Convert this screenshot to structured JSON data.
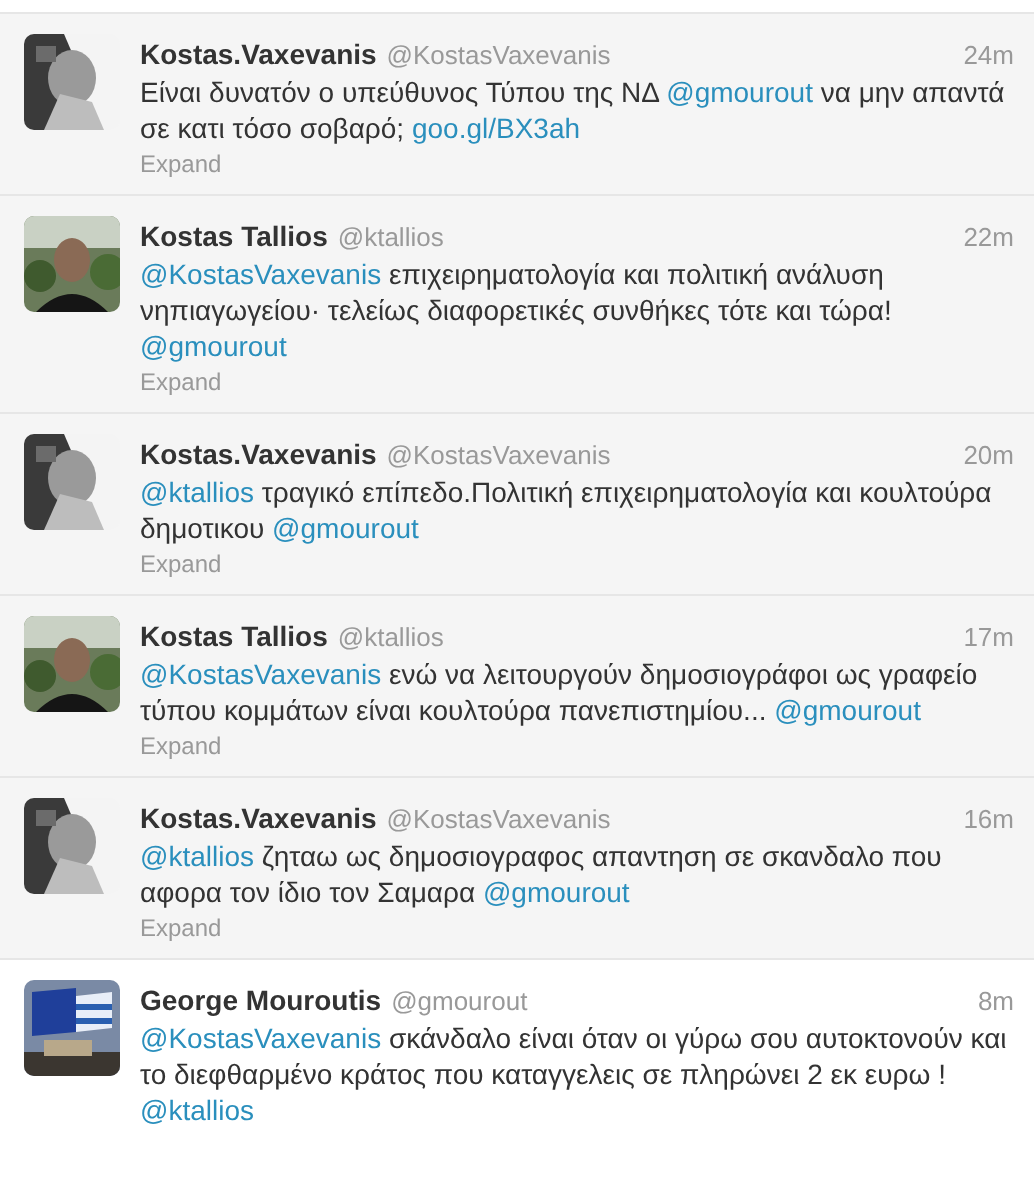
{
  "tweets": [
    {
      "name": "Kostas.Vaxevanis",
      "handle": "@KostasVaxevanis",
      "time": "24m",
      "avatar": {
        "kind": "gray"
      },
      "expanded": false,
      "expand": "Expand",
      "text": [
        {
          "kind": "text",
          "t": "Είναι δυνατόν ο υπεύθυνος Τύπου της ΝΔ "
        },
        {
          "kind": "mention",
          "t": "@gmourout"
        },
        {
          "kind": "text",
          "t": " να μην απαντά σε κατι τόσο σοβαρό; "
        },
        {
          "kind": "link",
          "t": "goo.gl/BX3ah"
        }
      ]
    },
    {
      "name": "Kostas Tallios",
      "handle": "@ktallios",
      "time": "22m",
      "avatar": {
        "kind": "dark"
      },
      "expanded": false,
      "expand": "Expand",
      "text": [
        {
          "kind": "mention",
          "t": "@KostasVaxevanis"
        },
        {
          "kind": "text",
          "t": " επιχειρηματολογία και πολιτική ανάλυση νηπιαγωγείου· τελείως διαφορετικές συνθήκες τότε και τώρα! "
        },
        {
          "kind": "mention",
          "t": "@gmourout"
        }
      ]
    },
    {
      "name": "Kostas.Vaxevanis",
      "handle": "@KostasVaxevanis",
      "time": "20m",
      "avatar": {
        "kind": "gray"
      },
      "expanded": false,
      "expand": "Expand",
      "text": [
        {
          "kind": "mention",
          "t": "@ktallios"
        },
        {
          "kind": "text",
          "t": " τραγικό επίπεδο.Πολιτική επιχειρηματολογία και κουλτούρα δημοτικου "
        },
        {
          "kind": "mention",
          "t": "@gmourout"
        }
      ]
    },
    {
      "name": "Kostas Tallios",
      "handle": "@ktallios",
      "time": "17m",
      "avatar": {
        "kind": "dark"
      },
      "expanded": false,
      "expand": "Expand",
      "text": [
        {
          "kind": "mention",
          "t": "@KostasVaxevanis"
        },
        {
          "kind": "text",
          "t": " ενώ να λειτουργούν δημοσιογράφοι ως γραφείο τύπου κομμάτων είναι κουλτούρα πανεπιστημίου... "
        },
        {
          "kind": "mention",
          "t": "@gmourout"
        }
      ]
    },
    {
      "name": "Kostas.Vaxevanis",
      "handle": "@KostasVaxevanis",
      "time": "16m",
      "avatar": {
        "kind": "gray"
      },
      "expanded": false,
      "expand": "Expand",
      "text": [
        {
          "kind": "mention",
          "t": "@ktallios"
        },
        {
          "kind": "text",
          "t": " ζηταω ως δημοσιογραφος απαντηση σε σκανδαλο που αφορα τον ίδιο τον Σαμαρα "
        },
        {
          "kind": "mention",
          "t": "@gmourout"
        }
      ]
    },
    {
      "name": "George Mouroutis",
      "handle": "@gmourout",
      "time": "8m",
      "avatar": {
        "kind": "flag"
      },
      "expanded": true,
      "text": [
        {
          "kind": "mention",
          "t": "@KostasVaxevanis"
        },
        {
          "kind": "text",
          "t": " σκάνδαλο είναι όταν οι γύρω σου αυτοκτονούν και το διεφθαρμένο κράτος που καταγγελεις σε πληρώνει 2 εκ ευρω ! "
        },
        {
          "kind": "mention",
          "t": "@ktallios"
        }
      ]
    }
  ]
}
